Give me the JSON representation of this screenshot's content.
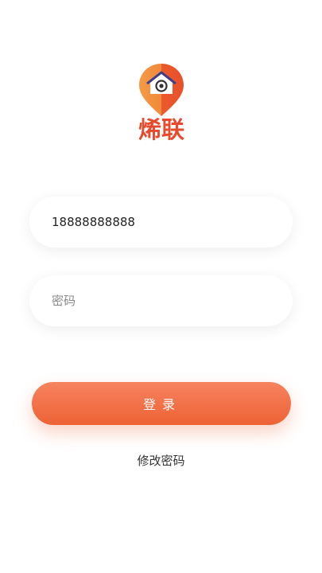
{
  "brand": {
    "name": "烯联",
    "pin_color": "#ee6235",
    "pin_highlight": "#f7a04b",
    "pin_inner": "#ffffff"
  },
  "login": {
    "phone_value": "18888888888",
    "password_placeholder": "密码",
    "submit_label": "登录",
    "change_password_label": "修改密码"
  }
}
